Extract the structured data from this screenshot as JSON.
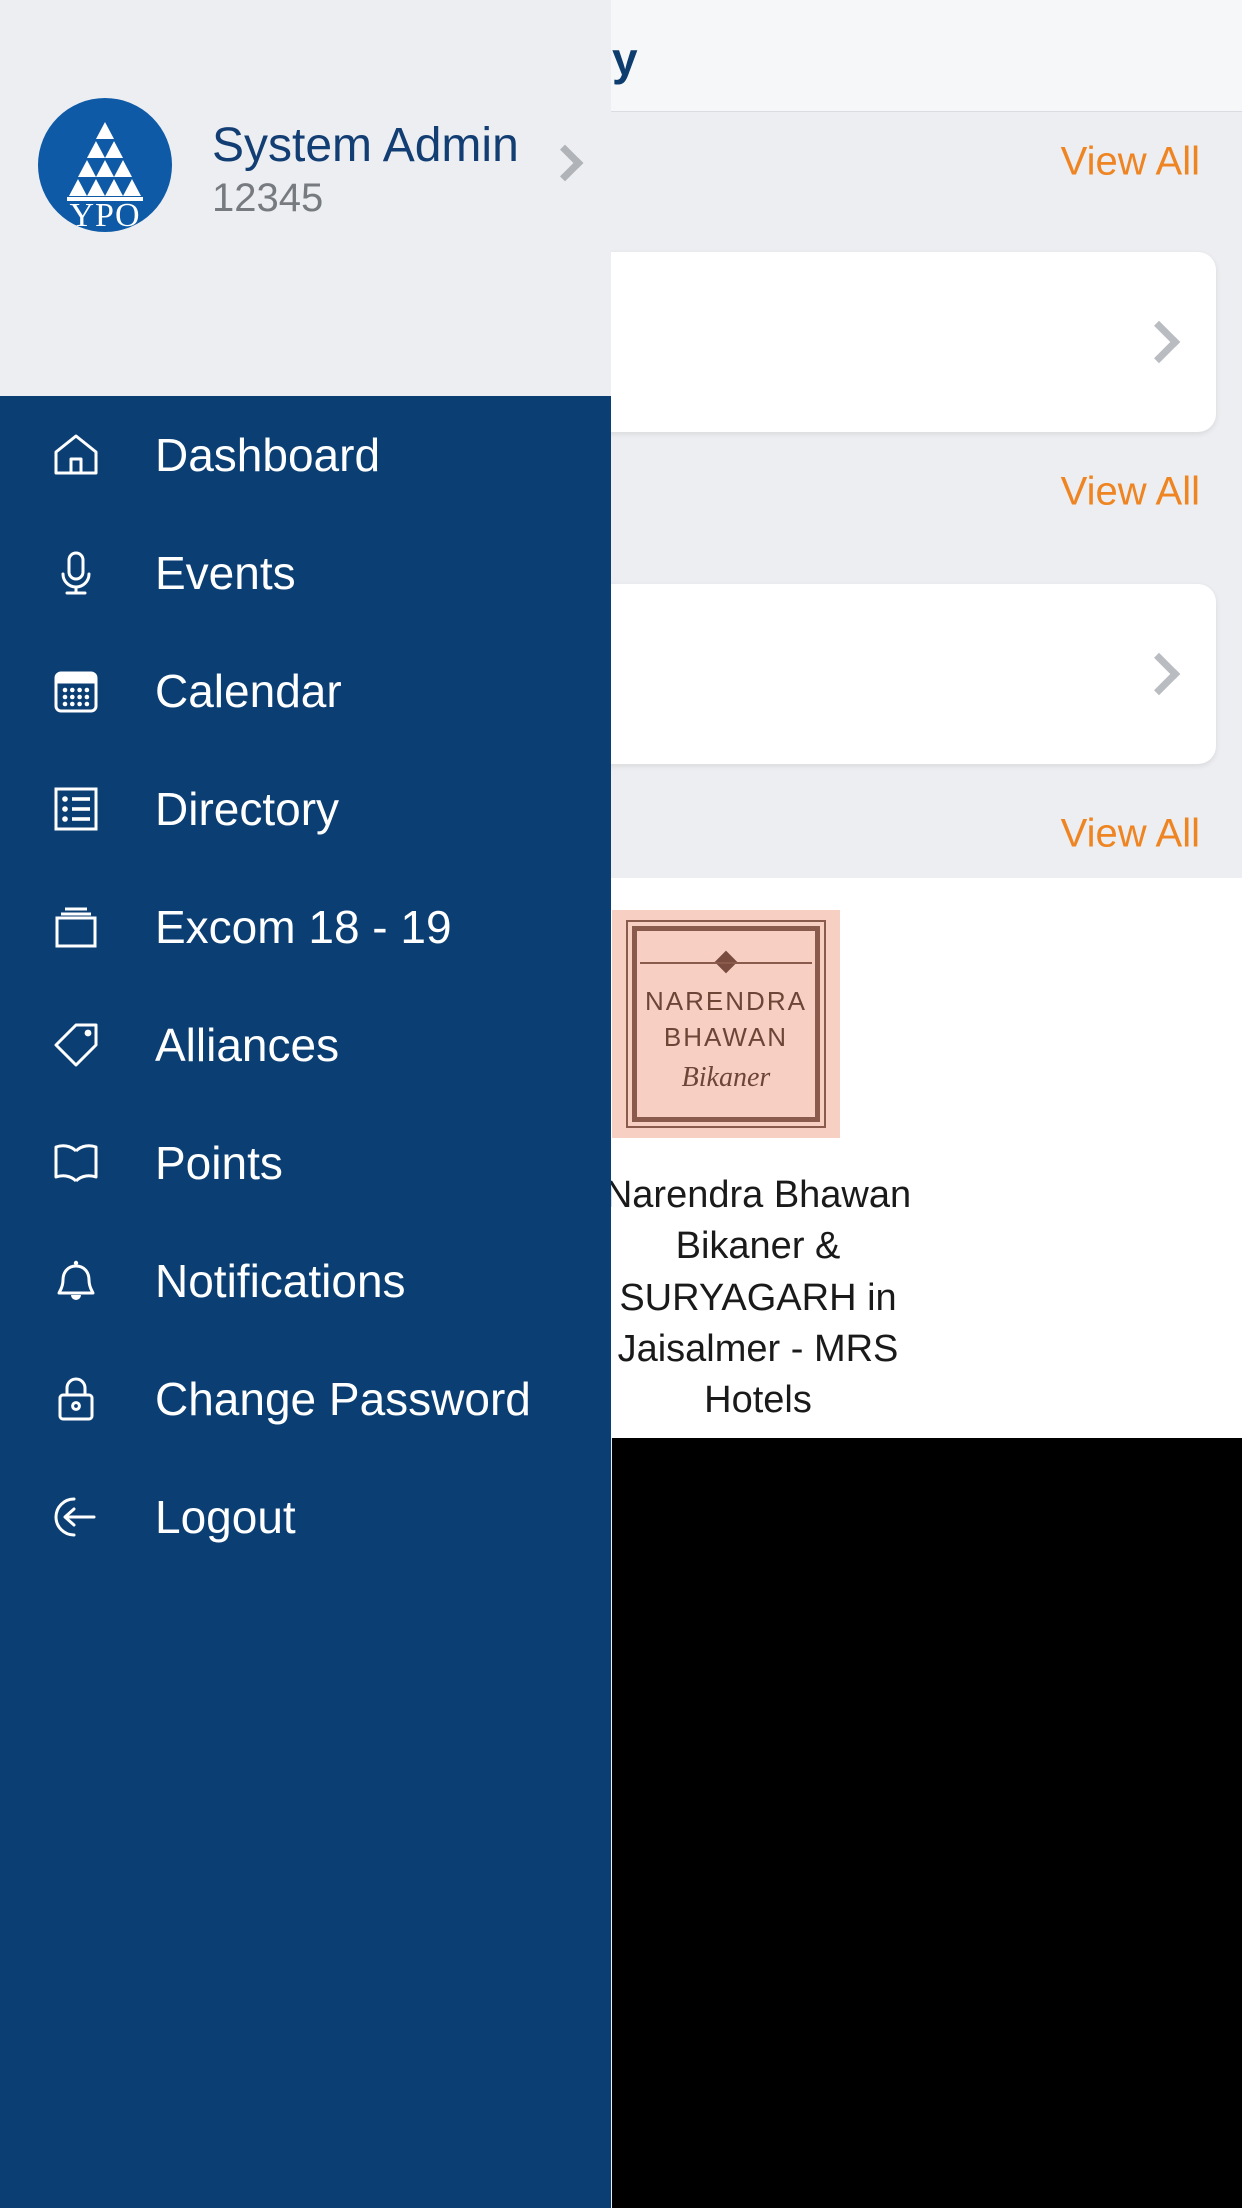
{
  "app": {
    "header_title_visible": "y",
    "sections": [
      {
        "view_all_label": "View All"
      },
      {
        "view_all_label": "View All"
      },
      {
        "view_all_label": "View All"
      }
    ],
    "alliance": {
      "thumb": {
        "brand_line1": "NARENDRA",
        "brand_line2": "BHAWAN",
        "brand_city": "Bikaner"
      },
      "caption": "Narendra Bhawan Bikaner & SURYAGARH in Jaisalmer - MRS Hotels"
    },
    "colors": {
      "accent_orange": "#ee8422",
      "brand_navy": "#0b3f74",
      "logo_blue": "#0e5aa7",
      "page_bg": "#eceef1",
      "card_bg": "#ffffff",
      "chevron_gray": "#b9bcc0"
    }
  },
  "drawer": {
    "profile": {
      "name": "System Admin",
      "id": "12345",
      "logo_text": "YPO",
      "chevron_icon": "chevron-right-icon"
    },
    "menu": [
      {
        "label": "Dashboard",
        "icon": "home-icon"
      },
      {
        "label": "Events",
        "icon": "microphone-icon"
      },
      {
        "label": "Calendar",
        "icon": "calendar-icon"
      },
      {
        "label": "Directory",
        "icon": "list-icon"
      },
      {
        "label": "Excom 18 - 19",
        "icon": "box-icon"
      },
      {
        "label": "Alliances",
        "icon": "tag-icon"
      },
      {
        "label": "Points",
        "icon": "book-icon"
      },
      {
        "label": "Notifications",
        "icon": "bell-icon"
      },
      {
        "label": "Change Password",
        "icon": "lock-icon"
      },
      {
        "label": "Logout",
        "icon": "logout-icon"
      }
    ]
  }
}
